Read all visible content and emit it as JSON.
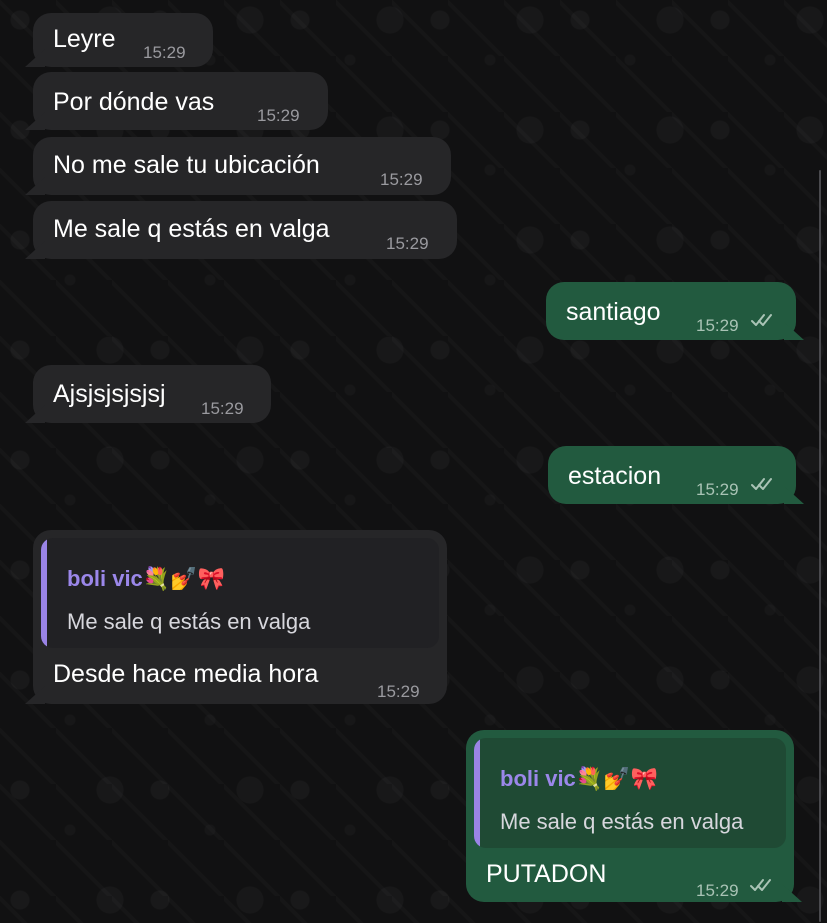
{
  "chat": {
    "messages": [
      {
        "text": "Leyre",
        "time": "15:29",
        "direction": "incoming"
      },
      {
        "text": "Por dónde vas",
        "time": "15:29",
        "direction": "incoming"
      },
      {
        "text": "No me sale tu ubicación",
        "time": "15:29",
        "direction": "incoming"
      },
      {
        "text": "Me sale q estás en valga",
        "time": "15:29",
        "direction": "incoming"
      },
      {
        "text": "santiago",
        "time": "15:29",
        "direction": "outgoing",
        "status": "read"
      },
      {
        "text": "Ajsjsjsjsjsj",
        "time": "15:29",
        "direction": "incoming"
      },
      {
        "text": "estacion",
        "time": "15:29",
        "direction": "outgoing",
        "status": "read"
      },
      {
        "text": "Desde hace media hora",
        "time": "15:29",
        "direction": "incoming",
        "reply": {
          "name": "boli vic💐💅🎀",
          "text": "Me sale q estás en valga"
        }
      },
      {
        "text": "PUTADON",
        "time": "15:29",
        "direction": "outgoing",
        "status": "read",
        "reply": {
          "name": "boli vic💐💅🎀",
          "text": "Me sale q estás en valga"
        }
      }
    ]
  },
  "colors": {
    "incoming_bubble": "#262628",
    "outgoing_bubble": "#225a3f",
    "reply_accent": "#9a84e6",
    "background": "#111112"
  },
  "icons": {
    "read_receipt": "double-check-icon",
    "scrollbar": "scrollbar-thumb"
  }
}
